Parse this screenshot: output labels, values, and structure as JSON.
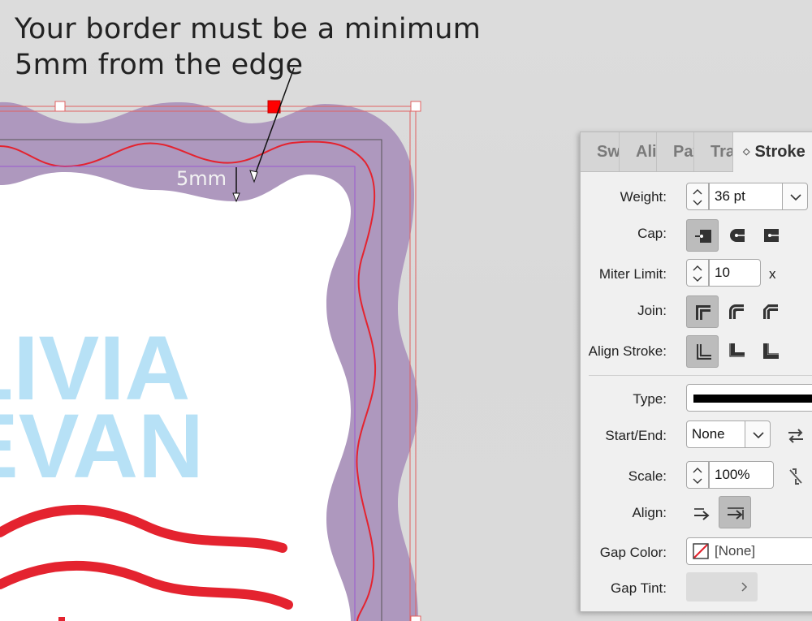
{
  "annotation": {
    "line1": "Your border must be a minimum",
    "line2": "5mm from the edge",
    "dimension_label": "5mm"
  },
  "artwork": {
    "name_line1": "LIVIA",
    "name_line2": "EVAN",
    "colors": {
      "border_purple": "#ae98be",
      "wave_red": "#e4232f",
      "text_blue": "#b7e1f6",
      "guide_purple": "#9b59d0",
      "bleed_red": "#e06060"
    }
  },
  "stroke_panel": {
    "tabs": [
      {
        "label": "Swatches",
        "icon": "swatches-icon"
      },
      {
        "label": "Align",
        "icon": "align-icon"
      },
      {
        "label": "Pathfinder",
        "icon": "pathfinder-icon"
      },
      {
        "label": "Transform",
        "icon": "transform-icon"
      },
      {
        "label": "Stroke",
        "active": true
      }
    ],
    "weight": {
      "label": "Weight:",
      "value": "36 pt"
    },
    "cap": {
      "label": "Cap:",
      "options": [
        "butt-cap-icon",
        "round-cap-icon",
        "projecting-cap-icon"
      ],
      "selected": 0
    },
    "miter": {
      "label": "Miter Limit:",
      "value": "10",
      "unit": "x"
    },
    "join": {
      "label": "Join:",
      "options": [
        "miter-join-icon",
        "round-join-icon",
        "bevel-join-icon"
      ],
      "selected": 0
    },
    "align_stroke": {
      "label": "Align Stroke:",
      "options": [
        "align-center-icon",
        "align-inside-icon",
        "align-outside-icon"
      ],
      "selected": 0
    },
    "type": {
      "label": "Type:"
    },
    "start_end": {
      "label": "Start/End:",
      "value": "None"
    },
    "scale": {
      "label": "Scale:",
      "value": "100%"
    },
    "align": {
      "label": "Align:",
      "options": [
        "extend-arrow-icon",
        "place-arrow-icon"
      ],
      "selected": 1
    },
    "gap_color": {
      "label": "Gap Color:",
      "value": "[None]"
    },
    "gap_tint": {
      "label": "Gap Tint:"
    }
  }
}
